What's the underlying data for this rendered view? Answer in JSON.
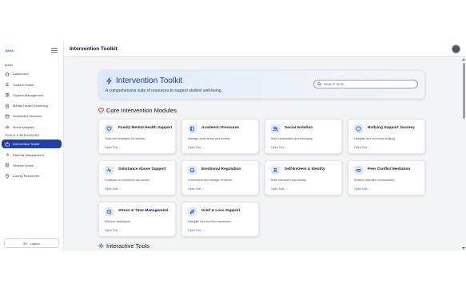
{
  "sidebar": {
    "logo": "Brisk",
    "sections": [
      {
        "label": "MAIN"
      },
      {
        "label": "TOOLS & RESOURCES"
      }
    ],
    "items": [
      {
        "label": "Dashboard",
        "icon": "home-icon"
      },
      {
        "label": "Student Roster",
        "icon": "user-icon"
      },
      {
        "label": "Student Management",
        "icon": "users-icon"
      },
      {
        "label": "Mental Health Screening",
        "icon": "clipboard-icon"
      },
      {
        "label": "Scheduled Sessions",
        "icon": "calendar-icon"
      },
      {
        "label": "Mood Analytics",
        "icon": "chart-icon"
      },
      {
        "label": "Intervention Toolkit",
        "icon": "toolbox-icon",
        "active": true
      },
      {
        "label": "Referral Management",
        "icon": "referral-icon"
      },
      {
        "label": "Session Notes",
        "icon": "notes-icon"
      },
      {
        "label": "County Resources",
        "icon": "location-icon"
      }
    ],
    "logout_label": "Logout"
  },
  "topbar": {
    "title": "Intervention Toolkit"
  },
  "hero": {
    "title": "Intervention Toolkit",
    "subtitle": "A comprehensive suite of resources to support student well-being.",
    "search_placeholder": "Search tools..."
  },
  "core_modules": {
    "title": "Core Intervention Modules",
    "cards": [
      {
        "title": "Family Mental Health Support",
        "desc": "Tools and strategies for families.",
        "link": "Open Tool →",
        "icon": "heart-icon"
      },
      {
        "title": "Academic Pressures",
        "desc": "Manage study stress and anxiety.",
        "link": "Open Tool →",
        "icon": "book-icon"
      },
      {
        "title": "Social Isolation",
        "desc": "Build connections and belonging.",
        "link": "Open Tool →",
        "icon": "people-icon"
      },
      {
        "title": "Bullying Support Journey",
        "desc": "Navigate and overcome bullying.",
        "link": "Open Tool →",
        "icon": "shield-icon"
      },
      {
        "title": "Substance Abuse Support",
        "desc": "Guidance on substance use issues.",
        "link": "Open Tool →",
        "icon": "pulse-icon"
      },
      {
        "title": "Emotional Regulation",
        "desc": "Understand and manage emotions.",
        "link": "Open Tool →",
        "icon": "face-icon"
      },
      {
        "title": "Self-Esteem & Identity",
        "desc": "Build self-worth and identity.",
        "link": "Open Tool →",
        "icon": "user-icon"
      },
      {
        "title": "Peer Conflict Mediation",
        "desc": "Resolve disputes constructively.",
        "link": "Open Tool →",
        "icon": "handshake-icon"
      },
      {
        "title": "Stress & Time Management",
        "desc": "Effective techniques.",
        "link": "Open Tool →",
        "icon": "clock-icon"
      },
      {
        "title": "Grief & Loss Support",
        "desc": "Navigate loss and find expression.",
        "link": "Open Tool →",
        "icon": "leaf-icon"
      }
    ]
  },
  "interactive_tools": {
    "title": "Interactive Tools"
  },
  "colors": {
    "accent": "#1e40af",
    "link": "#1d4ed8",
    "heart": "#dc2626"
  }
}
